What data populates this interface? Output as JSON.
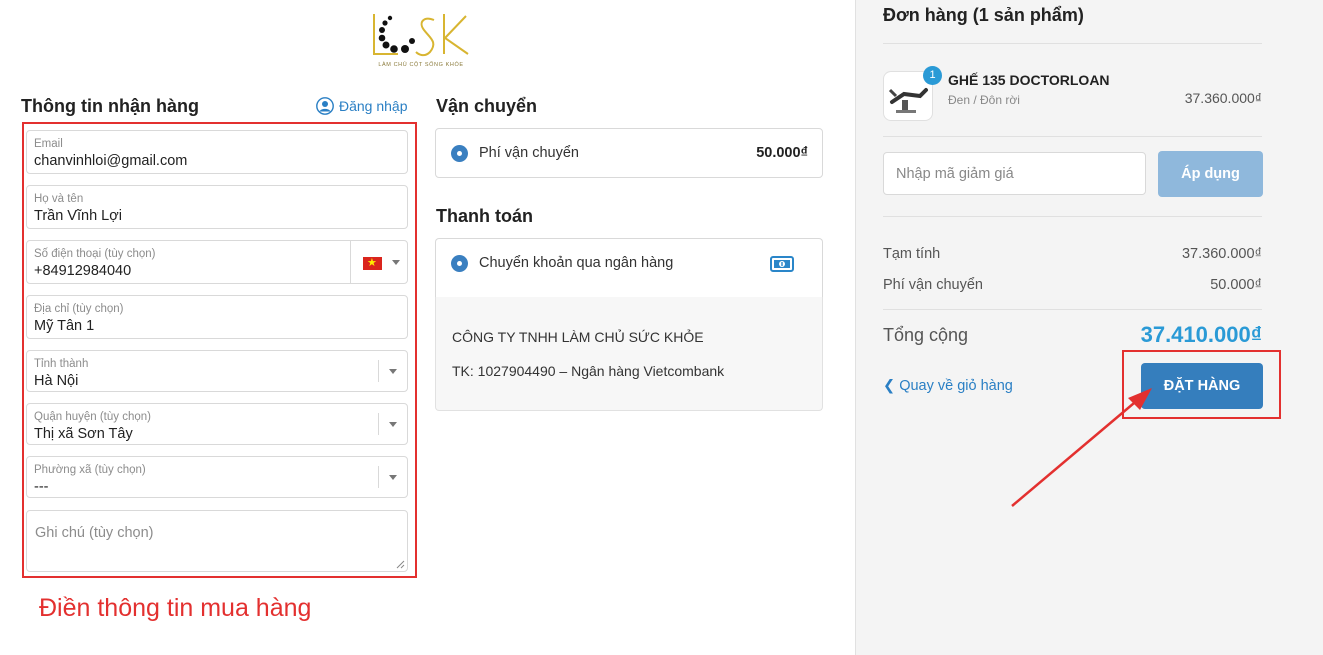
{
  "logo": {
    "text": "LCSK",
    "tagline": "LÀM CHỦ CỘT SỐNG KHỎE"
  },
  "shipping_info": {
    "title": "Thông tin nhận hàng",
    "login_label": "Đăng nhập",
    "fields": {
      "email": {
        "label": "Email",
        "value": "chanvinhloi@gmail.com"
      },
      "name": {
        "label": "Họ và tên",
        "value": "Trần Vĩnh Lợi"
      },
      "phone": {
        "label": "Số điện thoại (tùy chọn)",
        "value": "+84912984040",
        "country": "vn-flag-icon"
      },
      "address": {
        "label": "Địa chỉ (tùy chọn)",
        "value": "Mỹ Tân 1"
      },
      "province": {
        "label": "Tỉnh thành",
        "value": "Hà Nội"
      },
      "district": {
        "label": "Quận huyện (tùy chọn)",
        "value": "Thị xã Sơn Tây"
      },
      "ward": {
        "label": "Phường xã (tùy chọn)",
        "value": "---"
      },
      "note": {
        "placeholder": "Ghi chú (tùy chọn)"
      }
    }
  },
  "annotation": "Điền thông tin mua hàng",
  "shipping": {
    "title": "Vận chuyển",
    "option_label": "Phí vận chuyển",
    "option_price": "50.000₫"
  },
  "payment": {
    "title": "Thanh toán",
    "option_label": "Chuyển khoản qua ngân hàng",
    "option_icon": "money-icon",
    "company": "CÔNG TY TNHH LÀM CHỦ SỨC KHỎE",
    "account": "TK: 1027904490 – Ngân hàng Vietcombank"
  },
  "order": {
    "title": "Đơn hàng (1 sản phẩm)",
    "product": {
      "quantity": "1",
      "name": "GHẾ 135 DOCTORLOAN",
      "variant": "Đen / Đôn rời",
      "price": "37.360.000₫"
    },
    "coupon_placeholder": "Nhập mã giảm giá",
    "apply_label": "Áp dụng",
    "subtotal_label": "Tạm tính",
    "subtotal_value": "37.360.000₫",
    "shipping_label": "Phí vận chuyển",
    "shipping_value": "50.000₫",
    "total_label": "Tổng cộng",
    "total_value": "37.410.000₫",
    "back_label": "Quay về giỏ hàng",
    "submit_label": "ĐẶT HÀNG"
  },
  "colors": {
    "accent": "#357ebd",
    "highlight": "#e3302f",
    "total": "#2a9ad6"
  }
}
